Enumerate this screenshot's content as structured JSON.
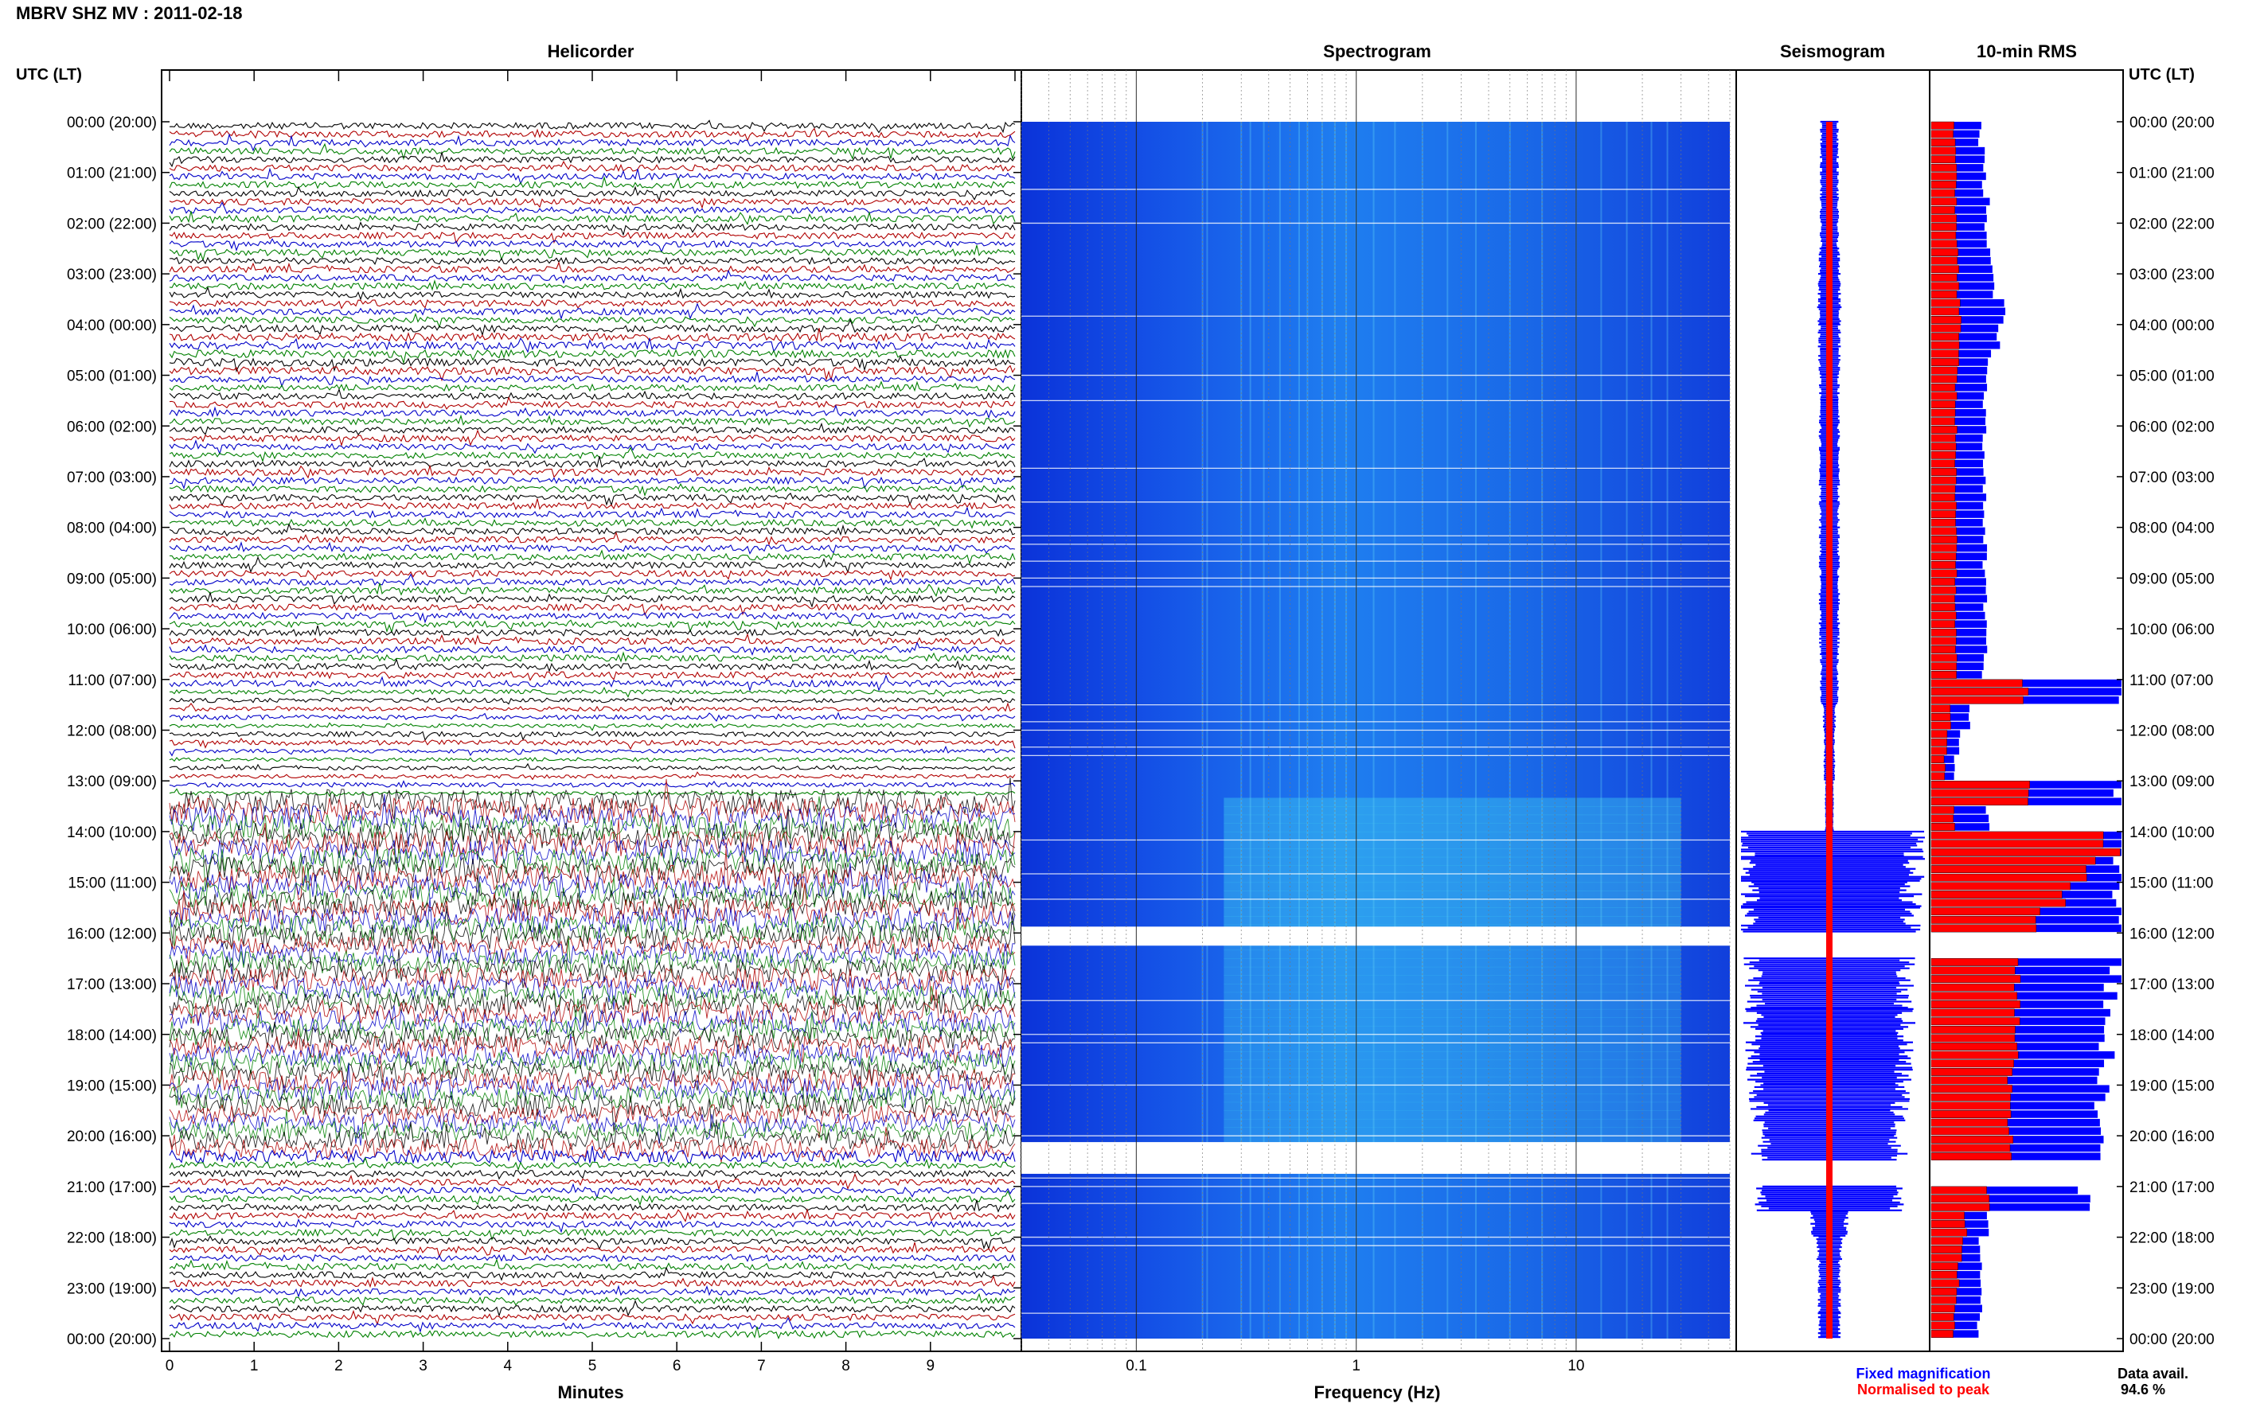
{
  "header": {
    "title": "MBRV SHZ MV : 2011-02-18"
  },
  "labels": {
    "left_axis": "UTC (LT)",
    "right_axis": "UTC (LT)",
    "data_avail_label": "Data avail.",
    "data_avail_value": "94.6 %",
    "fixed_magnification": "Fixed magnification",
    "normalised_to_peak": "Normalised to peak"
  },
  "colors": {
    "helicorder_traces": [
      "#000000",
      "#b00000",
      "#0000c8",
      "#008000"
    ],
    "fixed_magnification": "#0000ff",
    "normalised_to_peak": "#ff0000",
    "spectrogram_low": "#0a2fd8",
    "spectrogram_high": "#a8ff6a"
  },
  "chart_data": [
    {
      "type": "line",
      "title": "Helicorder",
      "xlabel": "Minutes",
      "x_ticks": [
        "0",
        "1",
        "2",
        "3",
        "4",
        "5",
        "6",
        "7",
        "8",
        "9"
      ],
      "xlim": [
        0,
        10
      ],
      "y_ticks": [
        "00:00 (20:00)",
        "01:00 (21:00)",
        "02:00 (22:00)",
        "03:00 (23:00)",
        "04:00 (00:00)",
        "05:00 (01:00)",
        "06:00 (02:00)",
        "07:00 (03:00)",
        "08:00 (04:00)",
        "09:00 (05:00)",
        "10:00 (06:00)",
        "11:00 (07:00)",
        "12:00 (08:00)",
        "13:00 (09:00)",
        "14:00 (10:00)",
        "15:00 (11:00)",
        "16:00 (12:00)",
        "17:00 (13:00)",
        "18:00 (14:00)",
        "19:00 (15:00)",
        "20:00 (16:00)",
        "21:00 (17:00)",
        "22:00 (18:00)",
        "23:00 (19:00)",
        "00:00 (20:00)"
      ],
      "rows": 144,
      "row_activity": [
        1,
        1,
        1,
        1,
        1,
        1,
        1,
        1,
        1,
        1,
        1,
        1,
        1,
        1,
        1,
        1,
        1,
        1,
        1,
        1,
        1,
        1,
        1,
        1,
        1.1,
        1.2,
        1.2,
        1.2,
        1.2,
        1.2,
        1,
        1,
        1,
        1,
        1,
        1,
        1,
        1,
        1,
        1,
        1,
        1,
        1,
        1,
        1,
        1,
        1,
        1,
        1,
        1,
        1,
        1,
        1,
        1,
        1,
        1,
        1,
        1,
        1,
        1,
        1,
        1,
        1,
        1,
        1,
        1,
        1,
        0.7,
        0.7,
        0.7,
        0.7,
        0.6,
        0.8,
        0.8,
        0.6,
        0.6,
        0.6,
        0.6,
        0.7,
        0.6,
        4,
        4,
        4,
        4,
        4,
        4,
        4,
        4,
        4,
        4,
        4,
        4,
        4,
        4,
        4,
        4,
        4,
        3,
        3.5,
        3.5,
        3.5,
        3.5,
        3.5,
        3.5,
        3.5,
        3.5,
        3.5,
        3.5,
        3.5,
        3.5,
        3.5,
        3.5,
        3.5,
        3.5,
        3.5,
        3.5,
        3.5,
        3,
        3,
        3,
        3,
        3,
        2,
        1,
        1,
        1,
        1,
        1,
        1,
        1,
        1,
        1,
        1,
        1,
        1,
        1,
        1,
        1,
        1,
        1,
        1,
        1
      ]
    },
    {
      "type": "heatmap",
      "title": "Spectrogram",
      "xlabel": "Frequency (Hz)",
      "x_scale": "log",
      "x_ticks": [
        "0.1",
        "1",
        "10"
      ],
      "xlim": [
        0.03,
        50
      ],
      "gaps_utc_hours": [
        [
          16.0,
          16.25
        ],
        [
          20.25,
          20.75
        ]
      ]
    },
    {
      "type": "bar",
      "title": "Seismogram",
      "hours": [
        0,
        0.5,
        1,
        1.5,
        2,
        2.5,
        3,
        3.5,
        4,
        4.5,
        5,
        5.5,
        6,
        6.5,
        7,
        7.5,
        8,
        8.5,
        9,
        9.5,
        10,
        10.5,
        11,
        11.5,
        12,
        12.5,
        13,
        13.5,
        14,
        14.5,
        15,
        15.5,
        16,
        16.5,
        17,
        17.5,
        18,
        18.5,
        19,
        19.5,
        20,
        20.5,
        21,
        21.5,
        22,
        22.5,
        23,
        23.5,
        24
      ],
      "amplitude": [
        0.1,
        0.1,
        0.1,
        0.1,
        0.1,
        0.11,
        0.12,
        0.13,
        0.12,
        0.12,
        0.11,
        0.11,
        0.11,
        0.11,
        0.11,
        0.11,
        0.11,
        0.11,
        0.11,
        0.11,
        0.11,
        0.1,
        0.1,
        0.07,
        0.06,
        0.06,
        0.05,
        0.05,
        1.0,
        1.0,
        0.98,
        0.95,
        0,
        0.9,
        0.88,
        0.9,
        0.9,
        0.88,
        0.86,
        0.82,
        0.82,
        0,
        0.82,
        0.2,
        0.14,
        0.12,
        0.12,
        0.12,
        0.12
      ]
    },
    {
      "type": "bar",
      "title": "10-min RMS",
      "hours": [
        0,
        0.5,
        1,
        1.5,
        2,
        2.5,
        3,
        3.5,
        4,
        4.5,
        5,
        5.5,
        6,
        6.5,
        7,
        7.5,
        8,
        8.5,
        9,
        9.5,
        10,
        10.5,
        11,
        11.5,
        12,
        12.5,
        13,
        13.5,
        14,
        14.5,
        15,
        15.5,
        16,
        16.5,
        17,
        17.5,
        18,
        18.5,
        19,
        19.5,
        20,
        20.5,
        21,
        21.5,
        22,
        22.5,
        23,
        23.5,
        24
      ],
      "fixed_magnification": [
        0.26,
        0.28,
        0.28,
        0.3,
        0.28,
        0.32,
        0.33,
        0.38,
        0.36,
        0.3,
        0.28,
        0.28,
        0.28,
        0.28,
        0.28,
        0.28,
        0.28,
        0.28,
        0.28,
        0.28,
        0.28,
        0.28,
        1.0,
        0.2,
        0.15,
        0.12,
        1.0,
        0.3,
        1.0,
        1.0,
        1.0,
        1.0,
        0,
        0.98,
        0.95,
        0.93,
        0.92,
        0.9,
        0.9,
        0.9,
        0.88,
        0,
        0.8,
        0.3,
        0.25,
        0.26,
        0.26,
        0.25,
        0.25
      ],
      "normalised_to_peak": [
        0.12,
        0.13,
        0.13,
        0.13,
        0.13,
        0.14,
        0.14,
        0.15,
        0.15,
        0.14,
        0.13,
        0.13,
        0.13,
        0.13,
        0.13,
        0.13,
        0.13,
        0.13,
        0.13,
        0.13,
        0.13,
        0.13,
        0.5,
        0.1,
        0.08,
        0.07,
        0.5,
        0.12,
        0.95,
        0.85,
        0.7,
        0.55,
        0,
        0.45,
        0.45,
        0.45,
        0.45,
        0.42,
        0.42,
        0.42,
        0.42,
        0,
        0.3,
        0.18,
        0.16,
        0.14,
        0.13,
        0.12,
        0.12
      ]
    }
  ]
}
